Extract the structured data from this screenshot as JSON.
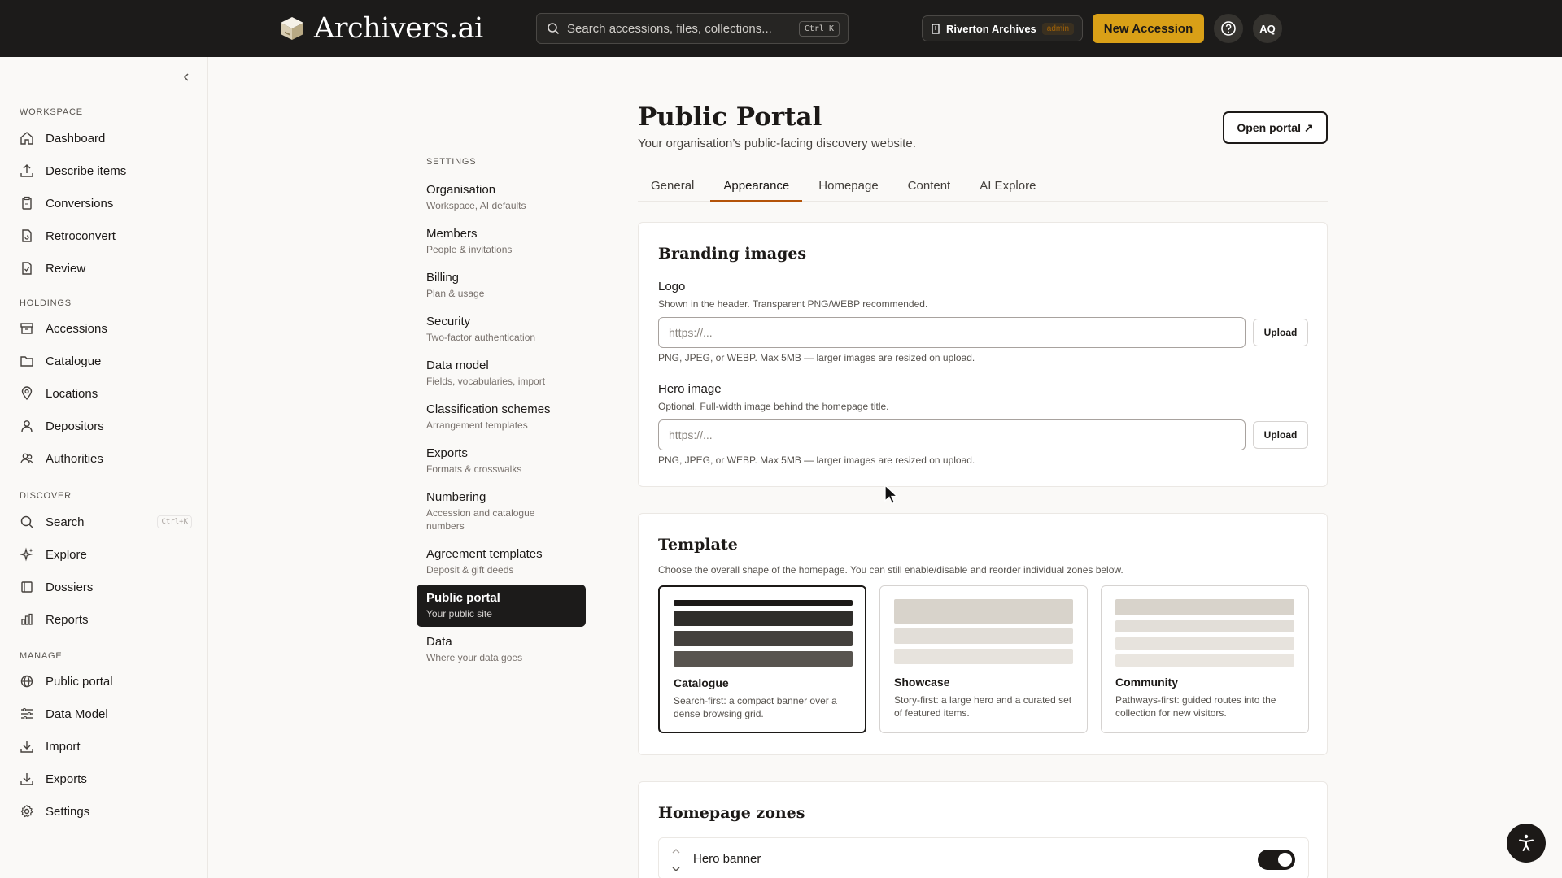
{
  "app": {
    "brand": "Archivers.ai",
    "search_placeholder": "Search accessions, files, collections...",
    "search_shortcut": "Ctrl K",
    "org_name": "Riverton Archives",
    "role_badge": "admin",
    "new_button": "New Accession",
    "help_icon": "question-circle-icon",
    "avatar_initials": "AQ",
    "accent_color": "#d9a017"
  },
  "sidebar": {
    "sections": [
      {
        "label": "WORKSPACE",
        "items": [
          {
            "label": "Dashboard",
            "icon": "home-icon"
          },
          {
            "label": "Describe items",
            "icon": "upload-icon"
          },
          {
            "label": "Conversions",
            "icon": "clipboard-icon"
          },
          {
            "label": "Retroconvert",
            "icon": "file-refresh-icon"
          },
          {
            "label": "Review",
            "icon": "file-check-icon"
          }
        ]
      },
      {
        "label": "HOLDINGS",
        "items": [
          {
            "label": "Accessions",
            "icon": "archive-box-icon"
          },
          {
            "label": "Catalogue",
            "icon": "folder-icon"
          },
          {
            "label": "Locations",
            "icon": "map-pin-icon"
          },
          {
            "label": "Depositors",
            "icon": "user-icon"
          },
          {
            "label": "Authorities",
            "icon": "users-icon"
          }
        ]
      },
      {
        "label": "DISCOVER",
        "items": [
          {
            "label": "Search",
            "icon": "search-icon",
            "shortcut": "Ctrl+K"
          },
          {
            "label": "Explore",
            "icon": "sparkles-icon"
          },
          {
            "label": "Dossiers",
            "icon": "dossier-icon"
          },
          {
            "label": "Reports",
            "icon": "bar-chart-icon"
          }
        ]
      },
      {
        "label": "MANAGE",
        "items": [
          {
            "label": "Public portal",
            "icon": "globe-icon"
          },
          {
            "label": "Data Model",
            "icon": "sliders-icon"
          },
          {
            "label": "Import",
            "icon": "download-icon"
          },
          {
            "label": "Exports",
            "icon": "download-icon"
          },
          {
            "label": "Settings",
            "icon": "gear-icon"
          }
        ]
      }
    ]
  },
  "settings_nav": {
    "title": "SETTINGS",
    "items": [
      {
        "title": "Organisation",
        "subtitle": "Workspace, AI defaults"
      },
      {
        "title": "Members",
        "subtitle": "People & invitations"
      },
      {
        "title": "Billing",
        "subtitle": "Plan & usage"
      },
      {
        "title": "Security",
        "subtitle": "Two-factor authentication"
      },
      {
        "title": "Data model",
        "subtitle": "Fields, vocabularies, import"
      },
      {
        "title": "Classification schemes",
        "subtitle": "Arrangement templates"
      },
      {
        "title": "Exports",
        "subtitle": "Formats & crosswalks"
      },
      {
        "title": "Numbering",
        "subtitle": "Accession and catalogue numbers"
      },
      {
        "title": "Agreement templates",
        "subtitle": "Deposit & gift deeds"
      },
      {
        "title": "Public portal",
        "subtitle": "Your public site",
        "active": true
      },
      {
        "title": "Data",
        "subtitle": "Where your data goes"
      }
    ]
  },
  "main": {
    "title": "Public Portal",
    "subtitle": "Your organisation’s public-facing discovery website.",
    "open_button": "Open portal ↗",
    "tabs": [
      "General",
      "Appearance",
      "Homepage",
      "Content",
      "AI Explore"
    ],
    "active_tab": "Appearance",
    "branding": {
      "title": "Branding images",
      "logo": {
        "label": "Logo",
        "help": "Shown in the header. Transparent PNG/WEBP recommended.",
        "placeholder": "https://...",
        "value": "",
        "upload": "Upload",
        "note": "PNG, JPEG, or WEBP. Max 5MB — larger images are resized on upload."
      },
      "hero": {
        "label": "Hero image",
        "help": "Optional. Full-width image behind the homepage title.",
        "placeholder": "https://...",
        "value": "",
        "upload": "Upload",
        "note": "PNG, JPEG, or WEBP. Max 5MB — larger images are resized on upload."
      }
    },
    "template": {
      "title": "Template",
      "help": "Choose the overall shape of the homepage. You can still enable/disable and reorder individual zones below.",
      "options": [
        {
          "name": "Catalogue",
          "desc": "Search-first: a compact banner over a dense browsing grid.",
          "selected": true
        },
        {
          "name": "Showcase",
          "desc": "Story-first: a large hero and a curated set of featured items.",
          "selected": false
        },
        {
          "name": "Community",
          "desc": "Pathways-first: guided routes into the collection for new visitors.",
          "selected": false
        }
      ]
    },
    "zones": {
      "title": "Homepage zones",
      "items": [
        {
          "name": "Hero banner",
          "enabled": true
        }
      ]
    }
  },
  "accessibility_button": "accessibility-icon"
}
